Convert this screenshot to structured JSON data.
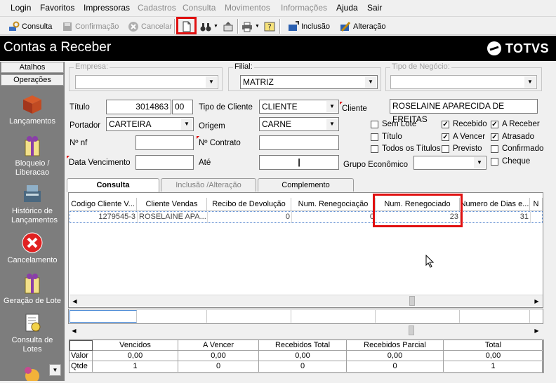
{
  "menu": [
    "Login",
    "Favoritos",
    "Impressoras",
    "Cadastros",
    "Consulta",
    "Movimentos",
    "Informações",
    "Ajuda",
    "Sair"
  ],
  "menu_disabled": [
    "Cadastros",
    "Consulta",
    "Movimentos",
    "Informações"
  ],
  "toolbar": {
    "consulta": "Consulta",
    "confirmacao": "Confirmação",
    "cancelar": "Cancelar",
    "inclusao": "Inclusão",
    "alteracao": "Alteração"
  },
  "window_title": "Contas a Receber",
  "brand": "TOTVS",
  "sidebar": {
    "tab_atalhos": "Atalhos",
    "tab_operacoes": "Operações",
    "items": [
      {
        "label": "Lançamentos",
        "icon": "box-icon"
      },
      {
        "label": "Bloqueio / Liberacao",
        "icon": "gift-box-icon"
      },
      {
        "label": "Histórico de Lançamentos",
        "icon": "cash-register-icon"
      },
      {
        "label": "Cancelamento",
        "icon": "cancel-icon"
      },
      {
        "label": "Geração de Lote",
        "icon": "gift-box-icon"
      },
      {
        "label": "Consulta de Lotes",
        "icon": "document-search-icon"
      }
    ]
  },
  "form": {
    "empresa_label": "Empresa:",
    "empresa_value": "",
    "filial_label": "Filial:",
    "filial_value": "MATRIZ",
    "tipo_negocio_label": "Tipo de Negócio:",
    "tipo_negocio_value": "",
    "titulo_label": "Título",
    "titulo_value": "3014863",
    "titulo_parcela": "00",
    "tipo_cliente_label": "Tipo de Cliente",
    "tipo_cliente_value": "CLIENTE",
    "cliente_label": "Cliente",
    "cliente_value": "ROSELAINE APARECIDA DE FREITAS",
    "portador_label": "Portador",
    "portador_value": "CARTEIRA",
    "origem_label": "Origem",
    "origem_value": "CARNE",
    "nf_label": "Nº nf",
    "nf_value": "",
    "contrato_label": "Nº Contrato",
    "contrato_value": "",
    "data_venc_label": "Data Vencimento",
    "data_venc_value": "",
    "ate_label": "Até",
    "ate_value": "|",
    "grupo_label": "Grupo Econômico",
    "grupo_value": ""
  },
  "checks": [
    {
      "label": "Sem Lote",
      "checked": false
    },
    {
      "label": "Título",
      "checked": false
    },
    {
      "label": "Todos os Títulos",
      "checked": false
    },
    {
      "label": "Recebido",
      "checked": true
    },
    {
      "label": "A Vencer",
      "checked": true
    },
    {
      "label": "Previsto",
      "checked": false
    },
    {
      "label": "A Receber",
      "checked": true
    },
    {
      "label": "Atrasado",
      "checked": true
    },
    {
      "label": "Confirmado",
      "checked": false
    },
    {
      "label": "Cheque",
      "checked": false
    }
  ],
  "tabs": [
    "Consulta",
    "Inclusão /Alteração",
    "Complemento"
  ],
  "grid": {
    "columns": [
      "Codigo Cliente V...",
      "Cliente Vendas",
      "Recibo de Devolução",
      "Num. Renegociação",
      "Num. Renegociado",
      "Numero de Dias e...",
      "N"
    ],
    "rows": [
      [
        "1279545-3",
        "ROSELAINE APA...",
        "0",
        "0",
        "23",
        "31",
        ""
      ]
    ]
  },
  "totals": {
    "headers": [
      "Vencidos",
      "A Vencer",
      "Recebidos Total",
      "Recebidos Parcial",
      "Total"
    ],
    "rows": [
      {
        "label": "Valor",
        "values": [
          "0,00",
          "0,00",
          "0,00",
          "0,00",
          "0,00"
        ]
      },
      {
        "label": "Qtde",
        "values": [
          "1",
          "0",
          "0",
          "0",
          "1"
        ]
      }
    ]
  },
  "colors": {
    "highlight_box": "#e01010",
    "title_bar": "#000000",
    "sidebar_bg": "#7d7d7d"
  }
}
